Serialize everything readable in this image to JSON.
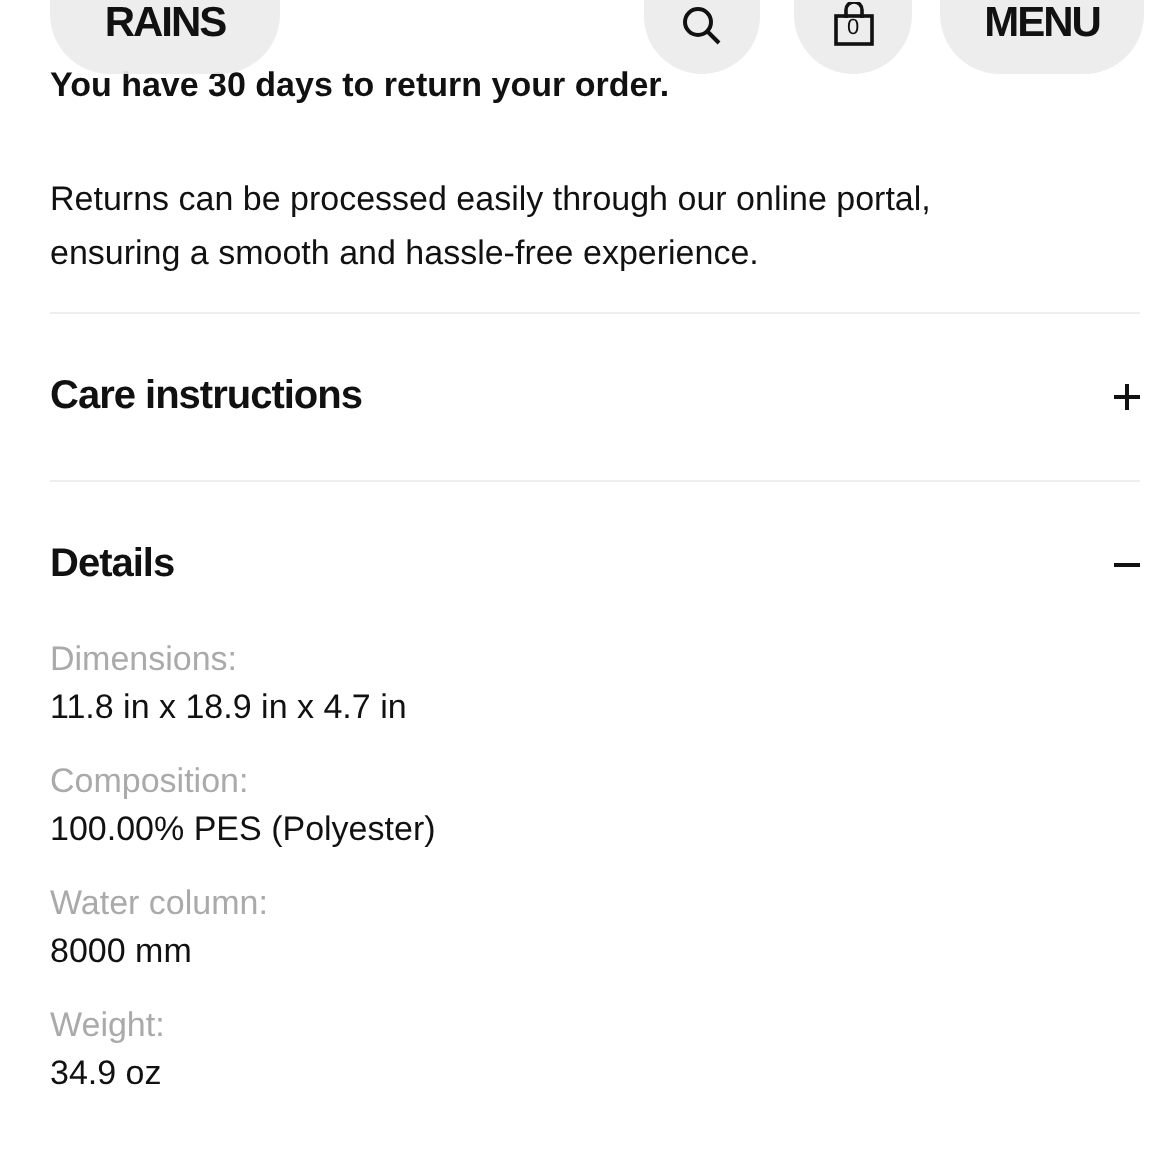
{
  "header": {
    "logo": "RAINS",
    "cart_count": "0",
    "menu": "MENU"
  },
  "returns": {
    "title": "You have 30 days to return your order.",
    "text": "Returns can be processed easily through our online portal, ensuring a smooth and hassle-free experience."
  },
  "sections": [
    {
      "title": "Care instructions",
      "expanded": false
    },
    {
      "title": "Details",
      "expanded": true,
      "details": [
        {
          "label": "Dimensions:",
          "value": "11.8 in x 18.9 in x 4.7 in"
        },
        {
          "label": "Composition:",
          "value": "100.00% PES (Polyester)"
        },
        {
          "label": "Water column:",
          "value": "8000 mm"
        },
        {
          "label": "Weight:",
          "value": "34.9 oz"
        }
      ]
    }
  ]
}
